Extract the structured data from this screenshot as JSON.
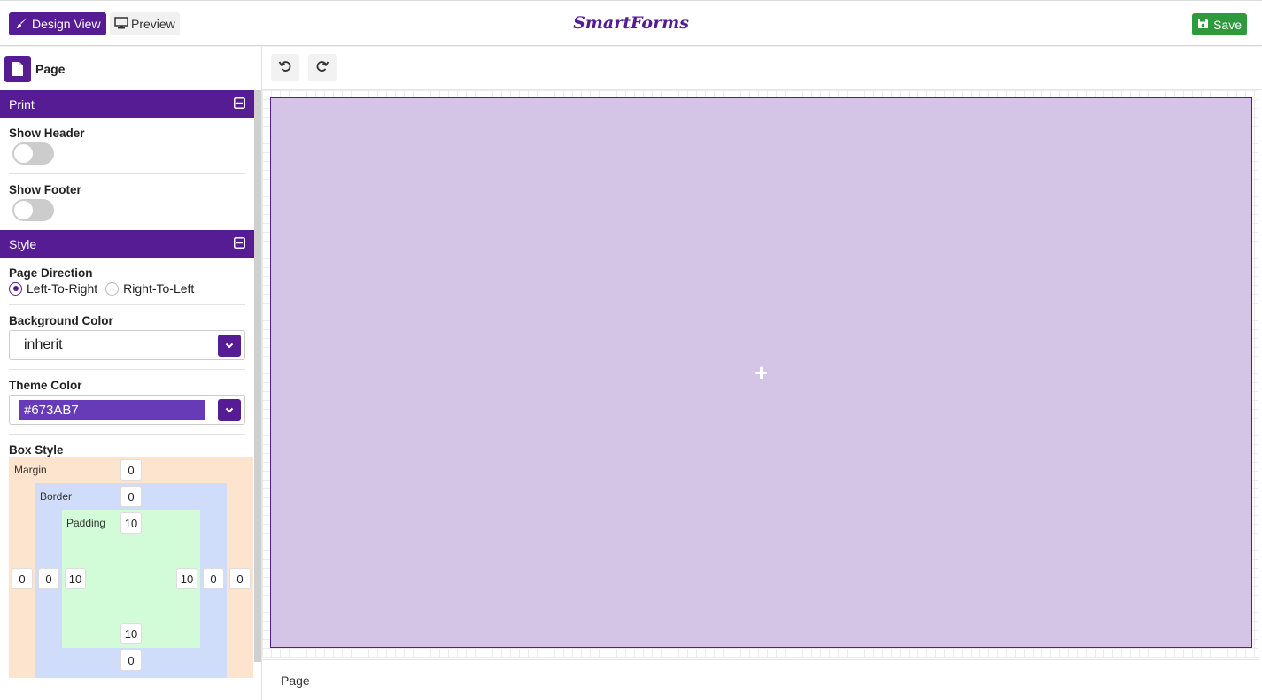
{
  "header": {
    "design_view_label": "Design View",
    "preview_label": "Preview",
    "brand": "SmartForms",
    "save_label": "Save"
  },
  "panel": {
    "title": "Page",
    "print": {
      "title": "Print",
      "show_header_label": "Show Header",
      "show_header_on": false,
      "show_footer_label": "Show Footer",
      "show_footer_on": false
    },
    "style": {
      "title": "Style",
      "page_direction_label": "Page Direction",
      "dir_options": [
        "Left-To-Right",
        "Right-To-Left"
      ],
      "dir_selected": "Left-To-Right",
      "background_color_label": "Background Color",
      "background_color_value": "inherit",
      "theme_color_label": "Theme Color",
      "theme_color_value": "#673AB7",
      "box_style_label": "Box Style",
      "box": {
        "margin_label": "Margin",
        "border_label": "Border",
        "padding_label": "Padding",
        "margin": {
          "top": "0",
          "right": "0",
          "bottom": "0",
          "left": "0"
        },
        "border": {
          "top": "0",
          "right": "0",
          "bottom": "0",
          "left": "0"
        },
        "padding": {
          "top": "10",
          "right": "10",
          "bottom": "10",
          "left": "10"
        }
      }
    }
  },
  "canvas": {
    "add_symbol": "+"
  },
  "footer": {
    "breadcrumb": "Page"
  },
  "colors": {
    "accent": "#561c94",
    "theme": "#673AB7",
    "save": "#2e9a3c",
    "page_fill": "#d4c4e5"
  }
}
